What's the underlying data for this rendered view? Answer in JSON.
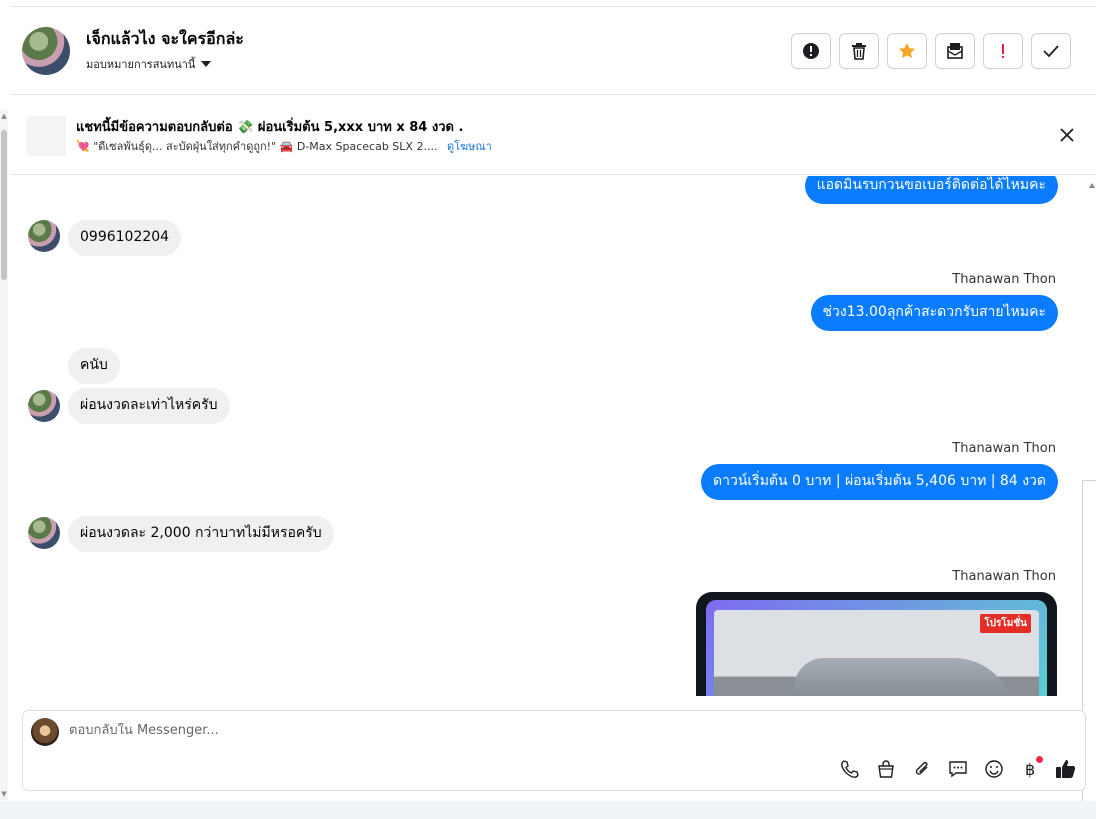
{
  "header": {
    "contact_name": "เจ็กแล้วไง จะใครอีกล่ะ",
    "assign_label": "มอบหมายการสนทนานี้",
    "actions": [
      {
        "name": "mark-spam-button",
        "icon": "exclamation-circle-icon"
      },
      {
        "name": "delete-button",
        "icon": "trash-icon"
      },
      {
        "name": "star-button",
        "icon": "star-icon"
      },
      {
        "name": "mark-unread-button",
        "icon": "envelope-icon"
      },
      {
        "name": "follow-up-button",
        "icon": "exclamation-icon"
      },
      {
        "name": "mark-done-button",
        "icon": "check-icon"
      }
    ],
    "star_color": "#f5a623",
    "follow_up_color": "#e41e3f"
  },
  "banner": {
    "title": "แชทนี้มีข้อความตอบกลับต่อ 💸 ผ่อนเริ่มต้น 5,xxx บาท x 84 งวด .",
    "subtitle": "💘 \"ดีเซลพันธุ์ดุ... สะบัดฝุ่นใส่ทุกคำดูถูก!\" 🚘 D-Max Spacecab SLX 2....",
    "link": "ดูโฆษณา"
  },
  "thread": {
    "messages": [
      {
        "dir": "out",
        "text": "แอดมินรบกวนขอเบอร์ติดต่อได้ไหมคะ"
      },
      {
        "dir": "in",
        "text": "0996102204"
      },
      {
        "dir": "out",
        "sender": "Thanawan Thon",
        "text": "ช่วง13.00ลุกค้าสะดวกรับสายไหมคะ"
      },
      {
        "dir": "in",
        "text": "คนับ"
      },
      {
        "dir": "in",
        "text": "ผ่อนงวดละเท่าไหร่ครับ"
      },
      {
        "dir": "out",
        "sender": "Thanawan Thon",
        "text": "ดาวน์เริ่มต้น 0 บาท | ผ่อนเริ่มต้น 5,406 บาท | 84 งวด"
      },
      {
        "dir": "in",
        "text": "ผ่อนงวดละ 2,000 กว่าบาทไม่มีหรอครับ"
      },
      {
        "dir": "out",
        "sender": "Thanawan Thon",
        "image_promo_label": "โปรโมชั่น"
      }
    ],
    "outgoing_color": "#0a7cff",
    "incoming_color": "#f0f0f0"
  },
  "composer": {
    "placeholder": "ตอบกลับใน Messenger...",
    "tools": [
      "phone-icon",
      "shopping-bag-icon",
      "paperclip-icon",
      "chat-bubble-icon",
      "smile-icon",
      "baht-icon",
      "thumbs-up-icon"
    ]
  }
}
